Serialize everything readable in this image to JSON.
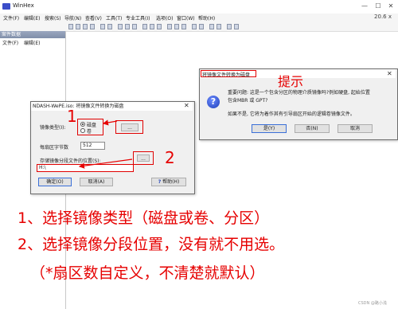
{
  "window": {
    "title": "WinHex",
    "version": "20.6 x"
  },
  "menu": [
    "文件(F)",
    "编辑(E)",
    "搜索(S)",
    "导航(N)",
    "查看(V)",
    "工具(T)",
    "专业工具(I)",
    "选项(O)",
    "窗口(W)",
    "帮助(H)"
  ],
  "left_panel": {
    "header": "案件数据",
    "menu": [
      "文件(F)",
      "编辑(E)"
    ]
  },
  "dialog1": {
    "title": "NDASH-WePE.iso: 将镜像文件转换为磁盘",
    "image_type_label": "镜像类型(I):",
    "radio_disk": "磁盘",
    "radio_volume": "卷",
    "small_button": "...",
    "sector_bytes_label": "每扇区字节数",
    "sector_bytes_value": "512",
    "segment_label": "存储镜像分段文件的位置(S):",
    "segment_value": "H:\\",
    "browse_button": "...",
    "ok": "确定(O)",
    "cancel": "取消(A)",
    "help": "帮助(H)"
  },
  "dialog2": {
    "title": "将镜像文件转换为磁盘",
    "line1": "重要问题: 这是一个包含分区的物理介质镜像吗?例如硬盘, 起始位置",
    "line2": "包含MBR 或 GPT?",
    "line3": "如果不是, 它将为着作其有引导扇区开始的逻辑卷镜像文件。",
    "yes": "是(Y)",
    "no": "否(N)",
    "cancel": "取消"
  },
  "annotations": {
    "label_1": "1",
    "label_2": "2",
    "hint": "提示",
    "caption1": "1、选择镜像类型（磁盘或卷、分区）",
    "caption2": "2、选择镜像分段位置，没有就不用选。",
    "caption3": "（*扇区数自定义，不清楚就默认）",
    "watermark": "CSDN @路小浅"
  },
  "colors": {
    "accent_red": "#e60000",
    "title_icon": "#3b4ec9"
  }
}
